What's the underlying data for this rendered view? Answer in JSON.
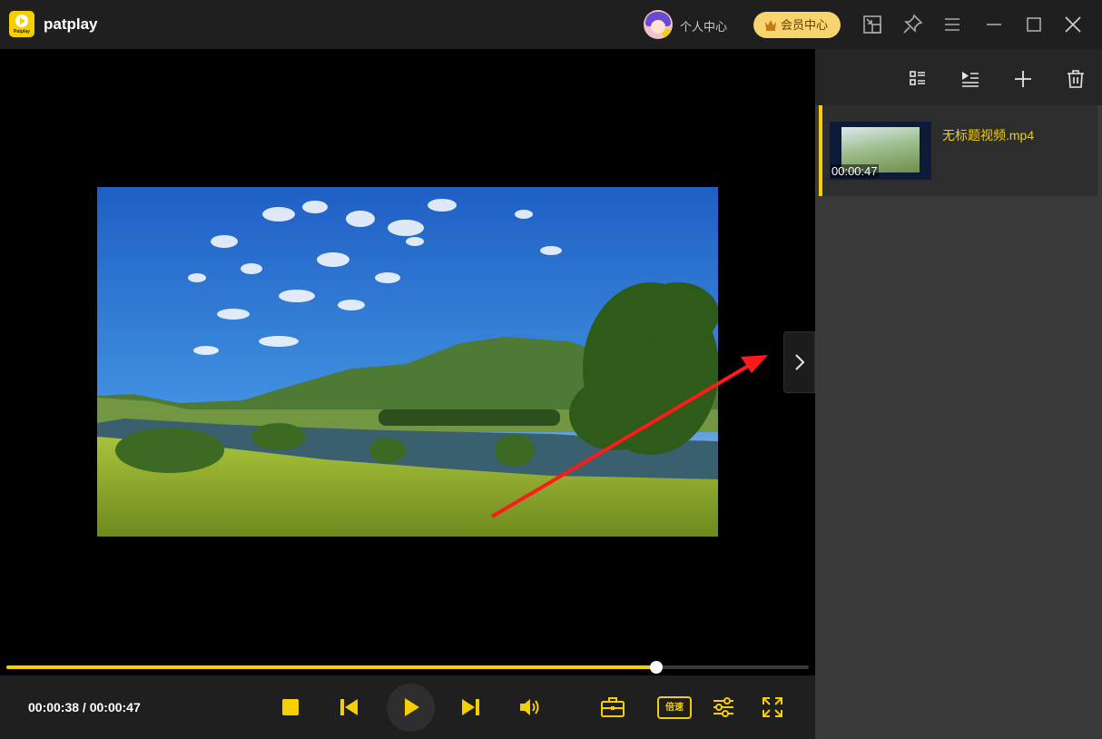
{
  "titlebar": {
    "app_name": "patplay",
    "logo_text": "Patplay",
    "personal_center": "个人中心",
    "vip_center": "会员中心"
  },
  "playback": {
    "current_time": "00:00:38",
    "total_time": "00:00:47",
    "time_display": "00:00:38 / 00:00:47",
    "progress_fraction": 0.81,
    "speed_label": "倍速"
  },
  "playlist": {
    "items": [
      {
        "name": "无标题视频.mp4",
        "duration": "00:00:47",
        "active": true
      }
    ]
  },
  "icons": {
    "titlebar": [
      "mini-player-icon",
      "pin-icon",
      "menu-icon",
      "minimize-icon",
      "maximize-icon",
      "close-icon"
    ],
    "sidebar": [
      "list-view-icon",
      "play-order-icon",
      "add-icon",
      "delete-icon"
    ],
    "controls": [
      "stop-icon",
      "previous-icon",
      "play-icon",
      "next-icon",
      "volume-icon",
      "toolbox-icon",
      "equalizer-icon",
      "fullscreen-icon"
    ]
  },
  "colors": {
    "accent": "#f5cf00",
    "titlebar_bg": "#1f1f1f",
    "sidebar_bg": "#3a3a3a",
    "vip_bg": "#f7d46d",
    "annotation_arrow": "#ff1a1a"
  }
}
